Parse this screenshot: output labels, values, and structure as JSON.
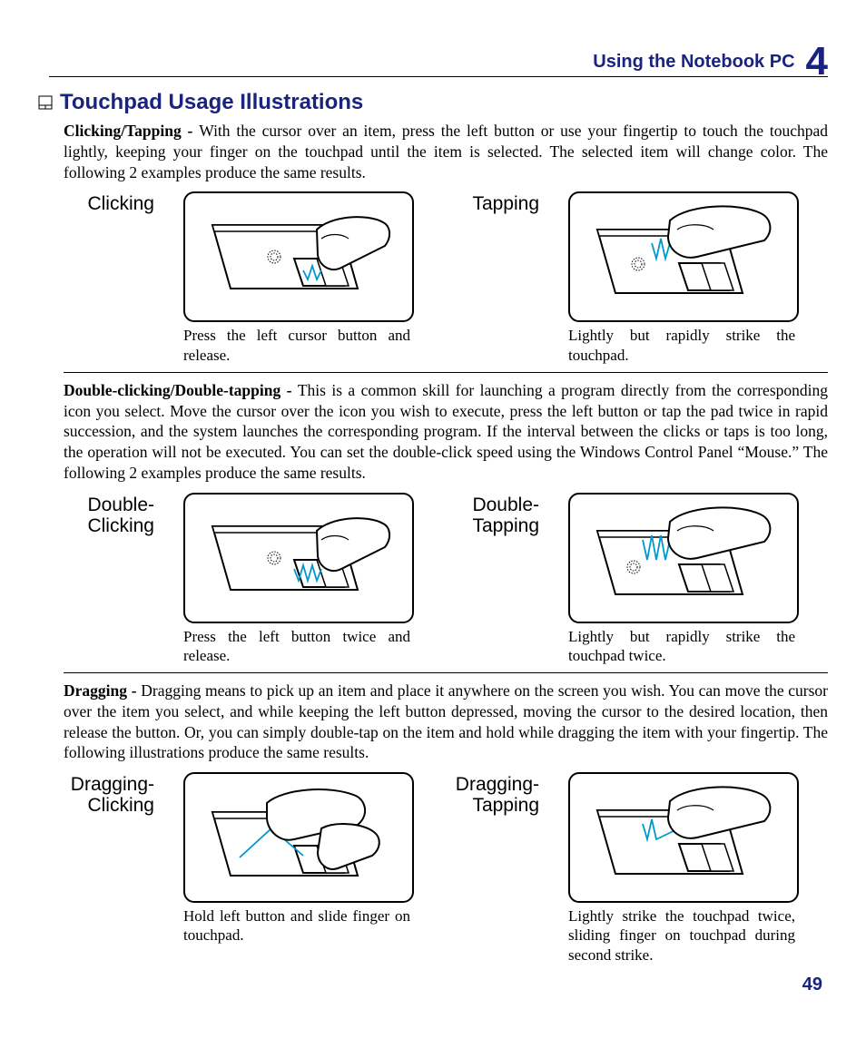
{
  "header": {
    "title": "Using the Notebook PC",
    "chapter_number": "4"
  },
  "section_heading": "Touchpad Usage Illustrations",
  "page_number": "49",
  "paragraphs": {
    "click_tap": {
      "lead": "Clicking/Tapping - ",
      "body": "With the cursor over an item, press the left button or use your fingertip to touch the touchpad lightly, keeping your finger on the touchpad until the item is selected. The selected item will change color. The following 2 examples produce the same results."
    },
    "double": {
      "lead": "Double-clicking/Double-tapping - ",
      "body": "This is a common skill for launching a program directly from the corresponding icon you select. Move the cursor over the icon you wish to execute, press the left button or tap the pad twice in rapid succession, and the system launches the corresponding program. If the interval between the clicks or taps is too long, the operation will not be executed. You can set the double-click speed using the Windows Control Panel “Mouse.” The following 2 examples produce the same results."
    },
    "drag": {
      "lead": "Dragging - ",
      "body": "Dragging means to pick up an item and place it anywhere on the screen you wish. You can move the cursor over the item you select, and while keeping the left button depressed, moving the cursor to the desired location, then release the button. Or, you can simply double-tap on the item and hold while dragging the item with your fingertip. The following illustrations produce the same results."
    }
  },
  "examples": {
    "click": {
      "left_label": "Clicking",
      "right_label": "Tapping",
      "left_caption": "Press the left cursor button and release.",
      "right_caption": "Lightly but rapidly strike the touchpad."
    },
    "double": {
      "left_label": "Double-\nClicking",
      "right_label": "Double-\nTapping",
      "left_caption": "Press the left button twice and release.",
      "right_caption": "Lightly but rapidly strike the touchpad twice."
    },
    "drag": {
      "left_label": "Dragging-\nClicking",
      "right_label": "Dragging-\nTapping",
      "left_caption": "Hold left button and slide finger on touchpad.",
      "right_caption": "Lightly strike the touchpad twice, sliding finger on touchpad during second strike."
    }
  }
}
